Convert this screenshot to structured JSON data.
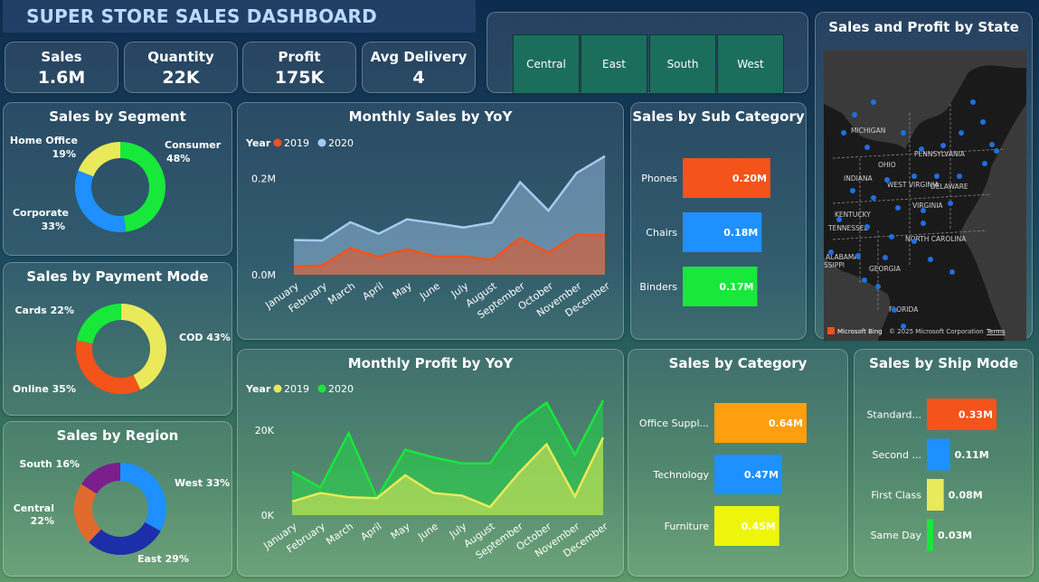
{
  "header": {
    "title": "SUPER STORE SALES DASHBOARD"
  },
  "kpis": [
    {
      "label": "Sales",
      "value": "1.6M"
    },
    {
      "label": "Quantity",
      "value": "22K"
    },
    {
      "label": "Profit",
      "value": "175K"
    },
    {
      "label": "Avg Delivery",
      "value": "4"
    }
  ],
  "region_filter": {
    "buttons": [
      "Central",
      "East",
      "South",
      "West"
    ]
  },
  "map": {
    "title": "Sales and Profit by State",
    "attribution": "© 2025 Microsoft Corporation",
    "bing_label": "Microsoft Bing",
    "terms": "Terms",
    "state_labels": [
      "MICHIGAN",
      "OHIO",
      "PENNSYLVANIA",
      "INDIANA",
      "WEST VIRGINIA",
      "DELAWARE",
      "KENTUCKY",
      "VIRGINIA",
      "TENNESSEE",
      "NORTH CAROLINA",
      "ALABAMA",
      "GEORGIA",
      "FLORIDA",
      "SSIPPI"
    ],
    "colors": {
      "background": "#1a1a1a",
      "water": "#3a3a3a",
      "dot": "#1f6fe0"
    }
  },
  "chart_data": [
    {
      "id": "segment",
      "type": "pie",
      "title": "Sales by Segment",
      "categories": [
        "Consumer",
        "Corporate",
        "Home Office"
      ],
      "values": [
        48,
        33,
        19
      ],
      "labels": [
        "Consumer",
        "48%",
        "Corporate",
        "33%",
        "Home Office",
        "19%"
      ],
      "colors": [
        "#17e83a",
        "#1e90ff",
        "#e9e95a"
      ]
    },
    {
      "id": "payment",
      "type": "pie",
      "title": "Sales by Payment Mode",
      "categories": [
        "COD",
        "Online",
        "Cards"
      ],
      "values": [
        43,
        35,
        22
      ],
      "labels": [
        "COD 43%",
        "Online 35%",
        "Cards 22%"
      ],
      "colors": [
        "#e9e95a",
        "#f4531a",
        "#17e83a"
      ]
    },
    {
      "id": "region",
      "type": "pie",
      "title": "Sales by Region",
      "categories": [
        "West",
        "East",
        "Central",
        "South"
      ],
      "values": [
        33,
        29,
        22,
        16
      ],
      "labels": [
        "West 33%",
        "East 29%",
        "Central",
        "22%",
        "South 16%"
      ],
      "colors": [
        "#1e90ff",
        "#1c2fa8",
        "#e06a2e",
        "#7a1f8c"
      ]
    },
    {
      "id": "monthly_sales",
      "type": "area",
      "title": "Monthly Sales by YoY",
      "legend_title": "Year",
      "categories": [
        "January",
        "February",
        "March",
        "April",
        "May",
        "June",
        "July",
        "August",
        "September",
        "October",
        "November",
        "December"
      ],
      "series": [
        {
          "name": "2020",
          "color": "#a7c9ef",
          "values": [
            0.072,
            0.071,
            0.109,
            0.085,
            0.115,
            0.107,
            0.098,
            0.108,
            0.192,
            0.133,
            0.211,
            0.246
          ]
        },
        {
          "name": "2019",
          "color": "#f4531a",
          "values": [
            0.017,
            0.019,
            0.055,
            0.037,
            0.053,
            0.038,
            0.038,
            0.031,
            0.076,
            0.046,
            0.083,
            0.082
          ]
        }
      ],
      "yticks": [
        "0.0M",
        "0.2M"
      ],
      "ylim": [
        0,
        0.3
      ]
    },
    {
      "id": "monthly_profit",
      "type": "area",
      "title": "Monthly Profit by YoY",
      "legend_title": "Year",
      "categories": [
        "January",
        "February",
        "March",
        "April",
        "May",
        "June",
        "July",
        "August",
        "September",
        "October",
        "November",
        "December"
      ],
      "series": [
        {
          "name": "2020",
          "color": "#17e83a",
          "values": [
            10200,
            6500,
            19300,
            4000,
            15400,
            13600,
            12200,
            12200,
            21500,
            26500,
            14200,
            27000
          ]
        },
        {
          "name": "2019",
          "color": "#e9e95a",
          "values": [
            3200,
            5200,
            4200,
            4000,
            9400,
            5200,
            4600,
            1900,
            9800,
            16700,
            4400,
            18300
          ]
        }
      ],
      "yticks": [
        "0K",
        "20K"
      ],
      "ylim": [
        0,
        33000
      ]
    },
    {
      "id": "sub_category",
      "type": "bar",
      "title": "Sales by Sub Category",
      "categories": [
        "Phones",
        "Chairs",
        "Binders"
      ],
      "values": [
        0.2,
        0.18,
        0.17
      ],
      "value_labels": [
        "0.20M",
        "0.18M",
        "0.17M"
      ],
      "colors": [
        "#f4531a",
        "#1e90ff",
        "#17e83a"
      ],
      "xlim": [
        0,
        0.2
      ]
    },
    {
      "id": "category",
      "type": "bar",
      "title": "Sales by Category",
      "categories": [
        "Office Suppl...",
        "Technology",
        "Furniture"
      ],
      "values": [
        0.64,
        0.47,
        0.45
      ],
      "value_labels": [
        "0.64M",
        "0.47M",
        "0.45M"
      ],
      "colors": [
        "#ff9f0f",
        "#1e90ff",
        "#eef50a"
      ],
      "xlim": [
        0,
        0.64
      ]
    },
    {
      "id": "ship_mode",
      "type": "bar",
      "title": "Sales by Ship Mode",
      "categories": [
        "Standard...",
        "Second ...",
        "First Class",
        "Same Day"
      ],
      "values": [
        0.33,
        0.11,
        0.08,
        0.03
      ],
      "value_labels": [
        "0.33M",
        "0.11M",
        "0.08M",
        "0.03M"
      ],
      "colors": [
        "#f4531a",
        "#1e90ff",
        "#e9e95a",
        "#17e83a"
      ],
      "xlim": [
        0,
        0.33
      ]
    }
  ]
}
